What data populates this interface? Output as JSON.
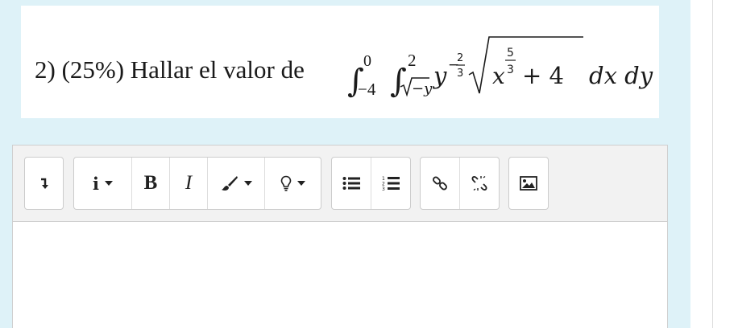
{
  "question": {
    "prefix": "2) (25%) Hallar el valor de",
    "math": {
      "outer_upper": "0",
      "outer_lower": "−4",
      "inner_upper": "2",
      "inner_lower_radicand": "−y",
      "integrand_base": "y",
      "exponent_sign": "−",
      "exponent_num": "2",
      "exponent_den": "3",
      "radicand_base": "x",
      "radicand_exp_num": "5",
      "radicand_exp_den": "3",
      "radicand_tail": "+ 4",
      "differentials": "dx dy"
    }
  },
  "toolbar": {
    "groups": [
      {
        "name": "toggle",
        "buttons": [
          {
            "icon": "toggle-toolbar-icon"
          }
        ]
      },
      {
        "name": "format",
        "buttons": [
          {
            "icon": "info-icon",
            "label": "i",
            "dropdown": true
          },
          {
            "icon": "bold-icon",
            "label": "B"
          },
          {
            "icon": "italic-icon",
            "label": "I"
          },
          {
            "icon": "paintbrush-icon",
            "dropdown": true
          },
          {
            "icon": "lightbulb-icon",
            "dropdown": true
          }
        ]
      },
      {
        "name": "lists",
        "buttons": [
          {
            "icon": "bullet-list-icon"
          },
          {
            "icon": "numbered-list-icon"
          }
        ]
      },
      {
        "name": "links",
        "buttons": [
          {
            "icon": "link-icon"
          },
          {
            "icon": "unlink-icon"
          }
        ]
      },
      {
        "name": "media",
        "buttons": [
          {
            "icon": "image-icon"
          }
        ]
      }
    ],
    "labels": {
      "info": "i",
      "bold": "B",
      "italic": "I"
    }
  },
  "editor": {
    "content": ""
  },
  "colors": {
    "panel_background": "#def2f8",
    "toolbar_background": "#f2f2f2",
    "text": "#1a1a1a"
  }
}
